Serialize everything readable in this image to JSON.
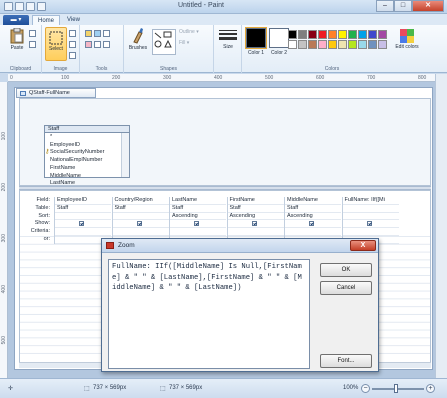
{
  "window": {
    "title": "Untitled - Paint",
    "controls": {
      "minimize": "–",
      "maximize": "□",
      "close": "✕"
    }
  },
  "ribbon": {
    "tabs": [
      "Home",
      "View"
    ],
    "groups": {
      "clipboard": {
        "label": "Clipboard",
        "paste": "Paste"
      },
      "image": {
        "label": "Image",
        "select": "Select"
      },
      "tools": {
        "label": "Tools"
      },
      "shapes": {
        "label": "Shapes",
        "brushes": "Brushes",
        "outline": "Outline ▾",
        "fill": "Fill ▾"
      },
      "size": {
        "label": "Size"
      },
      "colors": {
        "label": "Colors",
        "color1": "Color 1",
        "color2": "Color 2",
        "edit": "Edit colors"
      }
    },
    "palette": [
      "#000000",
      "#7f7f7f",
      "#880015",
      "#ed1c24",
      "#ff7f27",
      "#fff200",
      "#22b14c",
      "#00a2e8",
      "#3f48cc",
      "#a349a4",
      "#ffffff",
      "#c3c3c3",
      "#b97a57",
      "#ffaec9",
      "#ffc90e",
      "#efe4b0",
      "#b5e61d",
      "#99d9ea",
      "#7092be",
      "#c8bfe7"
    ]
  },
  "ruler": {
    "h_ticks": [
      "0",
      "100",
      "200",
      "300",
      "400",
      "500",
      "600",
      "700",
      "800"
    ],
    "v_ticks": [
      "100",
      "200",
      "300",
      "400",
      "500"
    ]
  },
  "access": {
    "tab_title": "QStaff-FullName",
    "table": {
      "title": "Staff",
      "fields": [
        "*",
        "EmployeeID",
        "SocialSecurityNumber",
        "NationalEmplNumber",
        "FirstName",
        "MiddleName",
        "LastName"
      ]
    },
    "grid": {
      "row_labels": [
        "Field:",
        "Table:",
        "Sort:",
        "Show:",
        "Criteria:",
        "or:"
      ],
      "columns": [
        {
          "field": "EmployeeID",
          "table": "Staff",
          "sort": ""
        },
        {
          "field": "Country/Region",
          "table": "Staff",
          "sort": ""
        },
        {
          "field": "LastName",
          "table": "Staff",
          "sort": "Ascending"
        },
        {
          "field": "FirstName",
          "table": "Staff",
          "sort": "Ascending"
        },
        {
          "field": "MiddleName",
          "table": "Staff",
          "sort": "Ascending"
        },
        {
          "field": "FullName: IIf([Mi",
          "table": "",
          "sort": ""
        }
      ]
    }
  },
  "zoom_dialog": {
    "title": "Zoom",
    "close": "X",
    "expression": "FullName: IIf([MiddleName] Is Null,[FirstName] & \" \" & [LastName],[FirstName] & \" \" & [MiddleName] & \" \" & [LastName])",
    "ok": "OK",
    "cancel": "Cancel",
    "font": "Font..."
  },
  "status": {
    "selection_size": "737 × 569px",
    "image_size": "737 × 569px",
    "zoom": "100%"
  }
}
